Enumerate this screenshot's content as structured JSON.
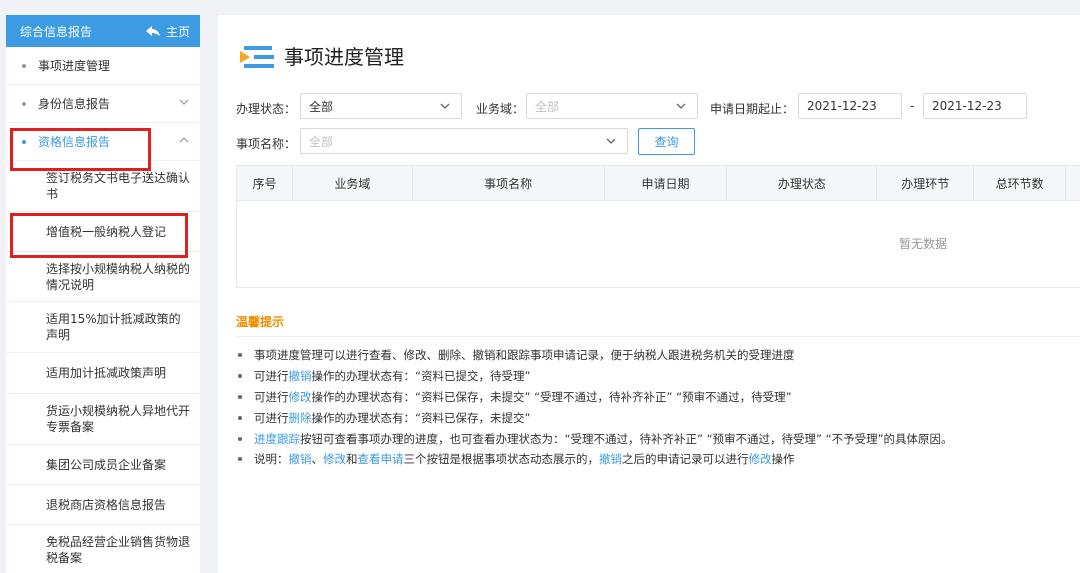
{
  "sidebar": {
    "header_title": "综合信息报告",
    "home_label": "主页",
    "items": [
      {
        "label": "事项进度管理"
      },
      {
        "label": "身份信息报告"
      },
      {
        "label": "资格信息报告"
      }
    ],
    "sub_items": [
      {
        "label": "签订税务文书电子送达确认书"
      },
      {
        "label": "增值税一般纳税人登记"
      },
      {
        "label": "选择按小规模纳税人纳税的情况说明"
      },
      {
        "label": "适用15%加计抵减政策的声明"
      },
      {
        "label": "适用加计抵减政策声明"
      },
      {
        "label": "货运小规模纳税人异地代开专票备案"
      },
      {
        "label": "集团公司成员企业备案"
      },
      {
        "label": "退税商店资格信息报告"
      },
      {
        "label": "免税品经营企业销售货物退税备案"
      }
    ]
  },
  "main": {
    "title": "事项进度管理",
    "filters": {
      "status_label": "办理状态：",
      "status_value": "全部",
      "domain_label": "业务域：",
      "domain_value": "全部",
      "date_label": "申请日期起止：",
      "date_start": "2021-12-23",
      "date_sep": "-",
      "date_end": "2021-12-23",
      "item_label": "事项名称：",
      "item_value": "全部",
      "query_button": "查询"
    },
    "table": {
      "columns": [
        "序号",
        "业务域",
        "事项名称",
        "申请日期",
        "办理状态",
        "办理环节",
        "总环节数"
      ],
      "empty_text": "暂无数据"
    },
    "tips": {
      "title": "温馨提示",
      "lines": [
        {
          "t1": "事项进度管理可以进行查看、修改、删除、撤销和跟踪事项申请记录，便于纳税人跟进税务机关的受理进度"
        },
        {
          "t1": "可进行",
          "k1": "撤销",
          "t2": "操作的办理状态有：“资料已提交，待受理”"
        },
        {
          "t1": "可进行",
          "k1": "修改",
          "t2": "操作的办理状态有：“资料已保存，未提交”  “受理不通过，待补齐补正”  “预审不通过，待受理”"
        },
        {
          "t1": "可进行",
          "k1": "删除",
          "t2": "操作的办理状态有：“资料已保存，未提交”"
        },
        {
          "k1": "进度跟踪",
          "t2": "按钮可查看事项办理的进度，也可查看办理状态为：“受理不通过，待补齐补正”  “预审不通过，待受理”  “不予受理”的具体原因。"
        },
        {
          "t1": "说明：",
          "k1": "撤销",
          "t2": "、",
          "k2": "修改",
          "t3": "和",
          "k3": "查看申请",
          "t4": "三个按钮是根据事项状态动态展示的，",
          "k4": "撤销",
          "t5": "之后的申请记录可以进行",
          "k5": "修改",
          "t6": "操作"
        }
      ]
    }
  }
}
